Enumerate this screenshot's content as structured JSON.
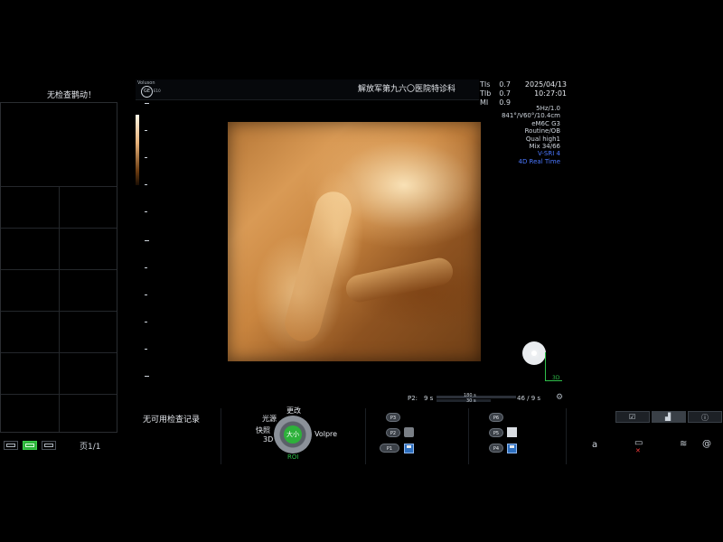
{
  "left_panel": {
    "title": "无检查鹊动！",
    "page_indicator": "页1/1"
  },
  "header": {
    "logo_brand": "Voluson",
    "logo_model": "E10",
    "hospital": "解放军第九六〇医院特诊科",
    "indices": [
      {
        "label": "TIs",
        "value": "0.7"
      },
      {
        "label": "TIb",
        "value": "0.7"
      },
      {
        "label": "MI",
        "value": "0.9"
      }
    ],
    "date": "2025/04/13",
    "time": "10:27:01"
  },
  "params": {
    "probe": "eM6C G3",
    "freq": "5Hz/1.0",
    "angles": "841°/V60°/10.4cm",
    "preset": "Routine/OB",
    "quality": "Qual high1",
    "mix": "Mix 34/66",
    "vsri": "V-SRI 4",
    "mode": "4D Real Time",
    "accent_color": "#4b78ff"
  },
  "overlay": {
    "axis_label": "3D"
  },
  "cine": {
    "label": "P2:",
    "start": "9 s",
    "mid_top": "180 s",
    "mid_bottom": "30 s",
    "frames": "46 / 9 s"
  },
  "bottom": {
    "no_records": "无可用检查记录",
    "dial": {
      "center": "大小",
      "change": "更改",
      "light": "光源",
      "fast": "快照",
      "three_d": "3D",
      "volpre": "Volpre",
      "roi": "ROI"
    },
    "p_buttons_left": [
      "P3",
      "P2",
      "P1"
    ],
    "p_buttons_right": [
      "P6",
      "P5",
      "P4"
    ]
  },
  "right_toolbar": {
    "icons": [
      "check-icon",
      "chart-icon",
      "info-icon"
    ],
    "status": "a"
  }
}
